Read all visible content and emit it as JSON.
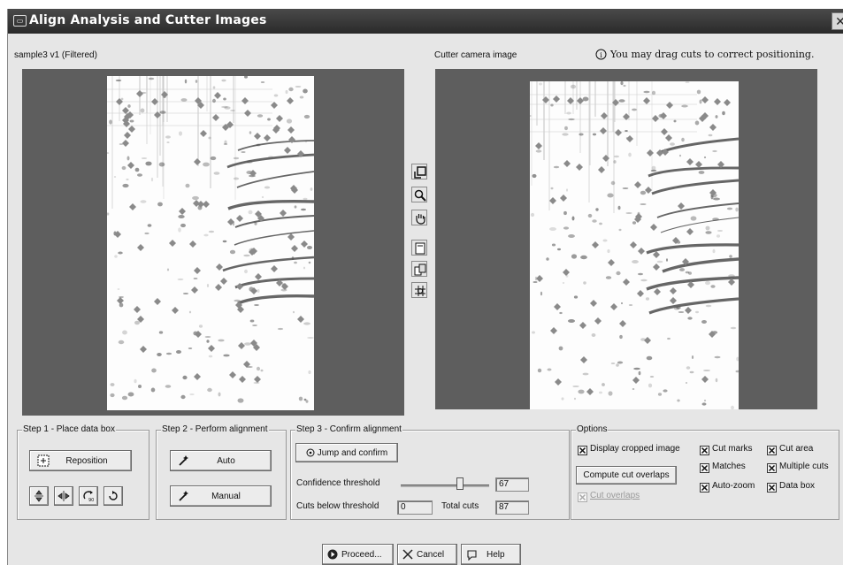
{
  "window": {
    "title": "Align Analysis and Cutter Images",
    "close_glyph": "✕"
  },
  "left_panel": {
    "label": "sample3 v1 (Filtered)"
  },
  "right_panel": {
    "label": "Cutter camera image",
    "hint": "You may drag cuts to correct positioning."
  },
  "toolbar": {
    "icons": [
      "crop-box-icon",
      "zoom-icon",
      "pan-hand-icon",
      "page-icon",
      "copy-icon",
      "grid-align-icon"
    ]
  },
  "step1": {
    "title": "Step 1 - Place data box",
    "reposition_label": "Reposition",
    "icons": [
      "flip-vertical-icon",
      "flip-horizontal-icon",
      "rotate-90-icon",
      "rotate-180-icon"
    ]
  },
  "step2": {
    "title": "Step 2 - Perform alignment",
    "auto_label": "Auto",
    "manual_label": "Manual"
  },
  "step3": {
    "title": "Step 3 - Confirm alignment",
    "jump_label": "Jump and confirm",
    "confidence_label": "Confidence threshold",
    "confidence_value": "67",
    "confidence_fraction": 0.67,
    "cuts_below_label": "Cuts below threshold",
    "cuts_below_value": "0",
    "total_cuts_label": "Total cuts",
    "total_cuts_value": "87"
  },
  "options": {
    "title": "Options",
    "display_cropped": "Display cropped image",
    "cut_marks": "Cut marks",
    "cut_area": "Cut area",
    "compute_label": "Compute cut overlaps",
    "matches": "Matches",
    "multiple_cuts": "Multiple cuts",
    "cut_overlaps": "Cut overlaps",
    "auto_zoom": "Auto-zoom",
    "data_box": "Data box"
  },
  "footer": {
    "proceed_label": "Proceed...",
    "cancel_label": "Cancel",
    "help_label": "Help"
  },
  "colors": {
    "spot_marker": "#8a8a8a",
    "panel_bg": "#5e5e5e",
    "title_bar": "#333333"
  }
}
